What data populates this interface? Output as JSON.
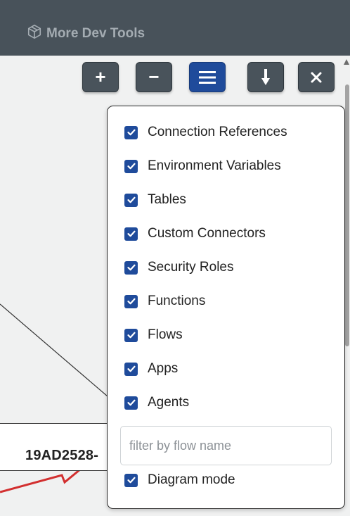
{
  "header": {
    "title": "More Dev Tools",
    "icon": "cube-icon"
  },
  "toolbar": {
    "buttons": [
      {
        "name": "zoom-in-button",
        "label": "+",
        "icon": "plus-icon"
      },
      {
        "name": "zoom-out-button",
        "label": "−",
        "icon": "minus-icon"
      },
      {
        "name": "menu-button",
        "label": "☰",
        "icon": "hamburger-menu-icon",
        "active": true
      },
      {
        "name": "download-button",
        "label": "⬇",
        "icon": "download-arrow-icon"
      },
      {
        "name": "close-button",
        "label": "×",
        "icon": "close-icon"
      }
    ]
  },
  "canvas": {
    "node_label": "19AD2528-"
  },
  "menu": {
    "options": [
      {
        "label": "Connection References",
        "checked": true
      },
      {
        "label": "Environment Variables",
        "checked": true
      },
      {
        "label": "Tables",
        "checked": true
      },
      {
        "label": "Custom Connectors",
        "checked": true
      },
      {
        "label": "Security Roles",
        "checked": true
      },
      {
        "label": "Functions",
        "checked": true
      },
      {
        "label": "Flows",
        "checked": true
      },
      {
        "label": "Apps",
        "checked": true
      },
      {
        "label": "Agents",
        "checked": true
      }
    ],
    "filter": {
      "placeholder": "filter by flow name",
      "value": ""
    },
    "diagram_mode": {
      "label": "Diagram mode",
      "checked": true
    }
  },
  "colors": {
    "header_bg": "#48525a",
    "button_bg": "#49535b",
    "active_button_bg": "#1f4b9b",
    "checkbox": "#1f4b9b",
    "edge_red": "#d22f2f"
  }
}
